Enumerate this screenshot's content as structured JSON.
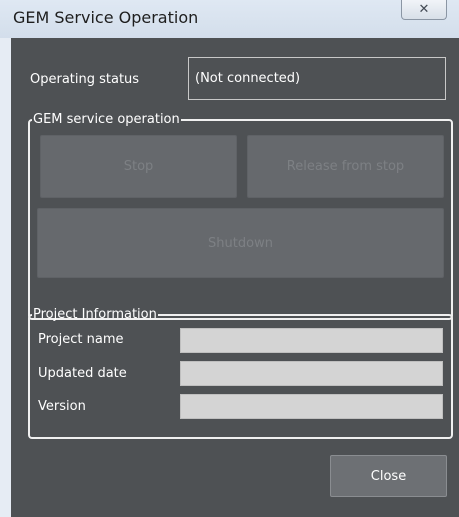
{
  "window": {
    "title": "GEM Service Operation",
    "close_glyph": "✕"
  },
  "status": {
    "label": "Operating status",
    "value": "(Not connected)"
  },
  "gem_operation": {
    "legend": "GEM service operation",
    "stop_label": "Stop",
    "release_label": "Release from stop",
    "shutdown_label": "Shutdown"
  },
  "project": {
    "legend": "Project Information",
    "name_label": "Project name",
    "name_value": "",
    "date_label": "Updated date",
    "date_value": "",
    "version_label": "Version",
    "version_value": ""
  },
  "footer": {
    "close_label": "Close"
  },
  "colors": {
    "client_bg": "#4e5154",
    "titlebar_bg": "#d9e3ef",
    "disabled_button": "#66696d",
    "field_bg": "#d4d4d4"
  }
}
